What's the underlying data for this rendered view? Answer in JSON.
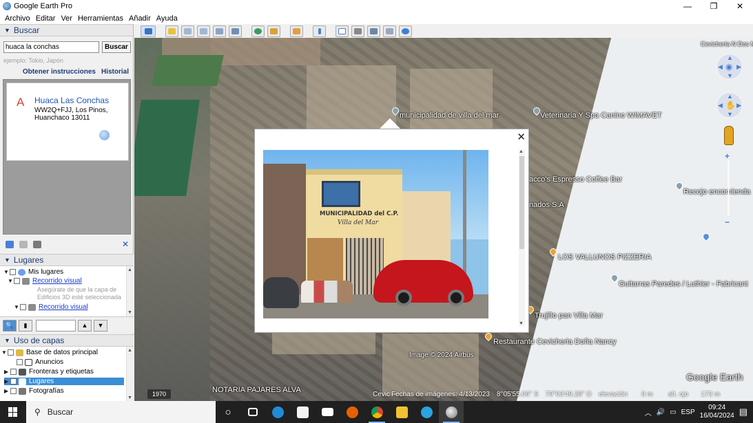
{
  "window": {
    "title": "Google Earth Pro",
    "minimize": "—",
    "restore": "❐",
    "close": "✕"
  },
  "menu": [
    "Archivo",
    "Editar",
    "Ver",
    "Herramientas",
    "Añadir",
    "Ayuda"
  ],
  "search_panel": {
    "header": "Buscar",
    "query": "huaca la conchas",
    "button": "Buscar",
    "example": "ejemplo: Tokio, Japón",
    "link_directions": "Obtener instrucciones",
    "link_history": "Historial",
    "result": {
      "marker": "A",
      "name": "Huaca Las Conchas",
      "address_line1": "WW2Q+FJJ, Los Pinos,",
      "address_line2": "Huanchaco 13011"
    },
    "close": "✕"
  },
  "places_panel": {
    "header": "Lugares",
    "rows": [
      {
        "label": "Mis lugares"
      },
      {
        "label": "Recorrido visual"
      },
      {
        "label": "Asegúrate de que la capa de"
      },
      {
        "label": "Edificios 3D esté seleccionada"
      },
      {
        "label": "Recorrido visual"
      }
    ]
  },
  "layers_panel": {
    "header": "Uso de capas",
    "rows": [
      {
        "label": "Base de datos principal"
      },
      {
        "label": "Anuncios"
      },
      {
        "label": "Fronteras y etiquetas"
      },
      {
        "label": "Lugares"
      },
      {
        "label": "Fotografías"
      }
    ]
  },
  "map": {
    "labels": {
      "cevicheria_n": "Cevicheria N Dos Mar",
      "municipalidad": "municipalidad de villa del mar",
      "veterinaria": "Veterinaria Y Spa Canino WIMAVET",
      "espresso": "acco's Espresso Coffee Bar",
      "recojo": "Recojo encomienda",
      "nados": "nados S.A",
      "vallunos": "LOS VALLUNOS PIZZERIA",
      "guitarras": "Guitarras Paredes / Luthier - Fabricant",
      "trujillo": "Trujillo pan Villa Mar",
      "restaurante": "Restaurante Cevicheria Doña Nancy",
      "image_credit": "Image © 2024 Airbus",
      "notaria": "NOTARIA PAJARES ALVA",
      "logo": "Google Earth"
    },
    "popup": {
      "close": "✕",
      "photo_sign_line1": "MUNICIPALIDAD del C.P.",
      "photo_sign_line2": "Villa del Mar"
    }
  },
  "status": {
    "year": "1970",
    "cev": "Cevic",
    "imagery_date": "Fechas de imágenes: 4/13/2023",
    "lat": "8°05'55.06\" S",
    "lon": "79°03'49.28\" O",
    "elevation_label": "elevación",
    "elevation_value": "0 m",
    "eye_alt_label": "alt. ojo",
    "eye_alt_value": "173 m"
  },
  "taskbar": {
    "search_placeholder": "Buscar",
    "language": "ESP",
    "time": "09:24",
    "date": "16/04/2024"
  },
  "colors": {
    "accent_blue": "#1a3b75",
    "link_blue": "#1a56b8",
    "marker_red": "#d9442b",
    "selection_blue": "#3a8ed6"
  }
}
